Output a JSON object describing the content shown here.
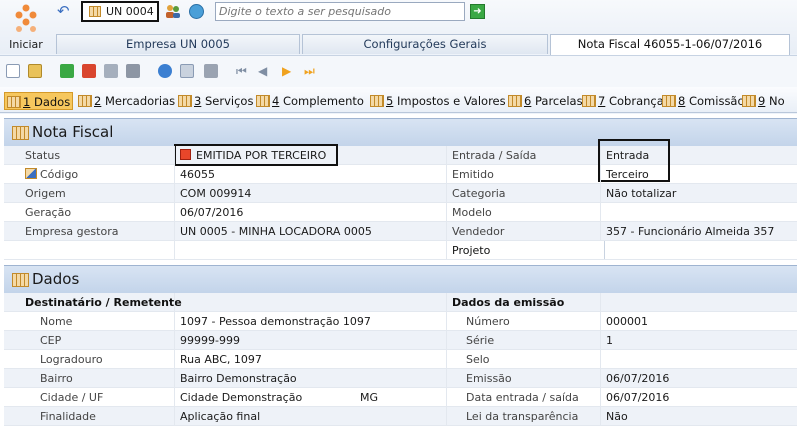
{
  "header": {
    "start_label": "Iniciar",
    "unit_label": "UN 0004",
    "search_placeholder": "Digite o texto a ser pesquisado"
  },
  "tabs": [
    {
      "label": "Empresa UN 0005"
    },
    {
      "label": "Configurações Gerais"
    },
    {
      "label": "Nota Fiscal 46055-1-06/07/2016"
    }
  ],
  "section_tabs": [
    {
      "num": "1",
      "label": " Dados"
    },
    {
      "num": "2",
      "label": " Mercadorias"
    },
    {
      "num": "3",
      "label": " Serviços"
    },
    {
      "num": "4",
      "label": " Complemento"
    },
    {
      "num": "5",
      "label": " Impostos e Valores"
    },
    {
      "num": "6",
      "label": " Parcelas"
    },
    {
      "num": "7",
      "label": " Cobrança"
    },
    {
      "num": "8",
      "label": " Comissão"
    },
    {
      "num": "9",
      "label": " No"
    }
  ],
  "nota": {
    "title": "Nota Fiscal",
    "status_label": "Status",
    "status_value": "EMITIDA POR TERCEIRO",
    "codigo_label": "Código",
    "codigo_value": "46055",
    "origem_label": "Origem",
    "origem_value": "COM 009914",
    "geracao_label": "Geração",
    "geracao_value": "06/07/2016",
    "empresa_label": "Empresa gestora",
    "empresa_value": "UN 0005 - MINHA LOCADORA 0005",
    "entrada_label": "Entrada / Saída",
    "entrada_value": "Entrada",
    "emitido_label": "Emitido",
    "emitido_value": "Terceiro",
    "categoria_label": "Categoria",
    "categoria_value": "Não totalizar",
    "modelo_label": "Modelo",
    "modelo_value": "",
    "vendedor_label": "Vendedor",
    "vendedor_value": "357 - Funcionário Almeida 357",
    "projeto_label": "Projeto",
    "projeto_value": ""
  },
  "dados": {
    "title": "Dados",
    "dest_head": "Destinatário / Remetente",
    "emissao_head": "Dados da emissão",
    "nome_label": "Nome",
    "nome_value": "1097 - Pessoa demonstração 1097",
    "cep_label": "CEP",
    "cep_value": "99999-999",
    "logradouro_label": "Logradouro",
    "logradouro_value": "Rua ABC, 1097",
    "bairro_label": "Bairro",
    "bairro_value": "Bairro Demonstração",
    "cidade_label": "Cidade / UF",
    "cidade_value": "Cidade Demonstração",
    "uf_value": "MG",
    "finalidade_label": "Finalidade",
    "finalidade_value": "Aplicação final",
    "numero_label": "Número",
    "numero_value": "000001",
    "serie_label": "Série",
    "serie_value": "1",
    "selo_label": "Selo",
    "selo_value": "",
    "emissao_label": "Emissão",
    "emissao_value": "06/07/2016",
    "data_es_label": "Data entrada / saída",
    "data_es_value": "06/07/2016",
    "lei_label": "Lei da transparência",
    "lei_value": "Não"
  }
}
